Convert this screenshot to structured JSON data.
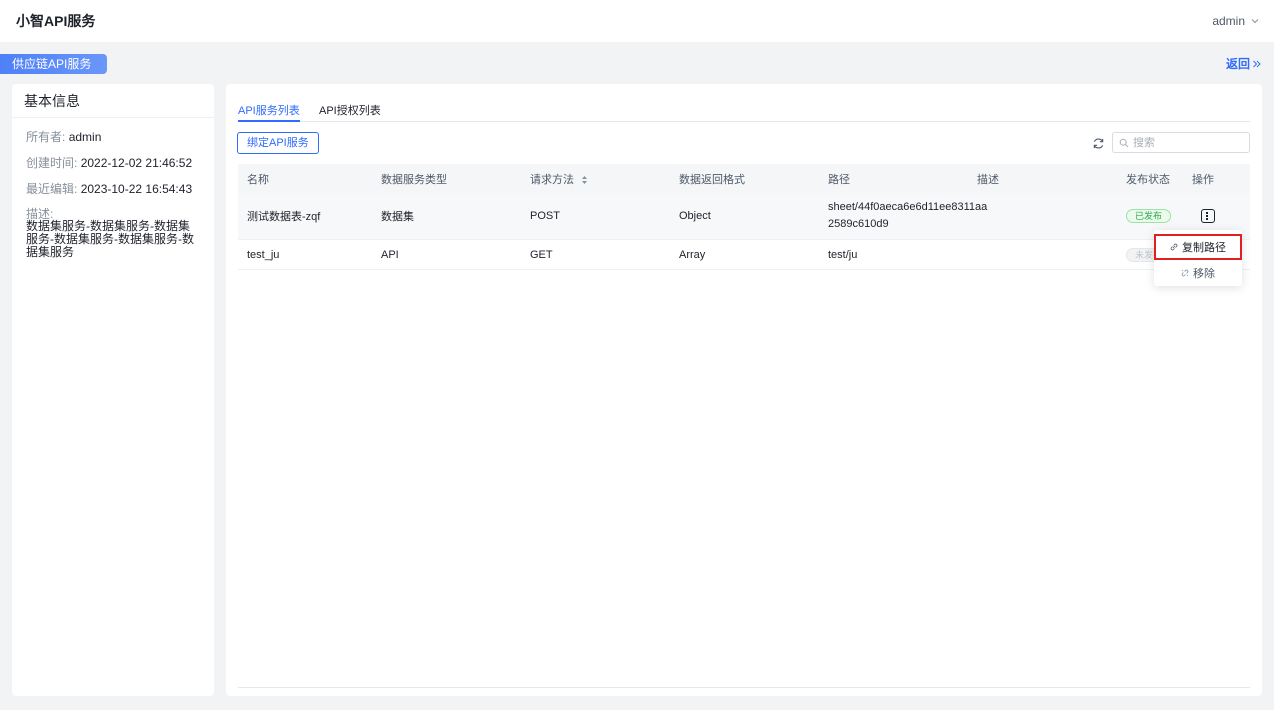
{
  "header": {
    "app_title": "小智API服务",
    "user_name": "admin"
  },
  "subbar": {
    "service_name": "供应链API服务",
    "back_label": "返回"
  },
  "basic_info": {
    "title": "基本信息",
    "owner_label": "所有者:",
    "owner": "admin",
    "created_label": "创建时间:",
    "created": "2022-12-02 21:46:52",
    "edited_label": "最近编辑:",
    "edited": "2023-10-22 16:54:43",
    "desc_label": "描述:",
    "desc": "数据集服务-数据集服务-数据集服务-数据集服务-数据集服务-数据集服务"
  },
  "tabs": [
    {
      "label": "API服务列表",
      "active": true
    },
    {
      "label": "API授权列表",
      "active": false
    }
  ],
  "toolbar": {
    "bind_label": "绑定API服务",
    "search_placeholder": "搜索"
  },
  "table": {
    "columns": [
      "名称",
      "数据服务类型",
      "请求方法",
      "数据返回格式",
      "路径",
      "描述",
      "发布状态",
      "操作"
    ],
    "rows": [
      {
        "name": "测试数据表-zqf",
        "type": "数据集",
        "method": "POST",
        "format": "Object",
        "path_line1": "sheet/44f0aeca6e6d11ee8311aa",
        "path_line2": "2589c610d9",
        "desc": "",
        "status": "已发布"
      },
      {
        "name": "test_ju",
        "type": "API",
        "method": "GET",
        "format": "Array",
        "path_line1": "test/ju",
        "path_line2": "",
        "desc": "",
        "status": "未发布"
      }
    ]
  },
  "dropdown": {
    "copy_path": "复制路径",
    "remove": "移除"
  },
  "colors": {
    "primary": "#2f6bff",
    "published": "#2ba84a",
    "highlight": "#e02020"
  }
}
